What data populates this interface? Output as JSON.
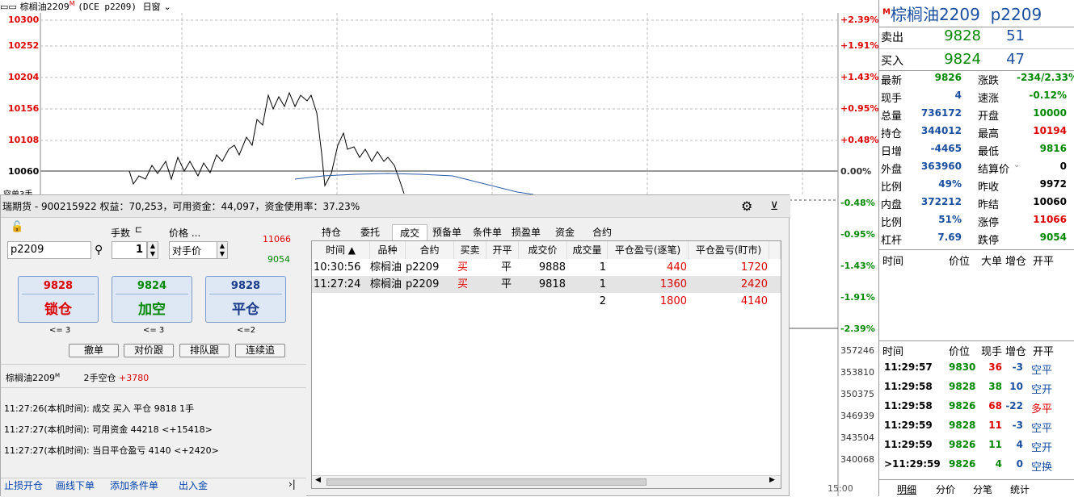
{
  "chart": {
    "instrument_tag": "棕榈油2209",
    "instrument_sup": "M",
    "instrument_code": "(DCE p2209)",
    "period": "日窗",
    "y_labels": [
      "10300",
      "10252",
      "10204",
      "10156",
      "10108",
      "10060"
    ],
    "pct_labels": [
      "+2.39%",
      "+1.91%",
      "+1.43%",
      "+0.95%",
      "+0.48%",
      "0.00%",
      "-0.48%",
      "-0.95%",
      "-1.43%",
      "-1.91%",
      "-2.39%"
    ],
    "vol_labels": [
      "357246",
      "353810",
      "350375",
      "346939",
      "343504",
      "340068"
    ],
    "partial_label": "空单3手",
    "time_label": "15:00"
  },
  "quote": {
    "title_sup": "M",
    "title": "棕榈油2209",
    "code": "p2209",
    "sell_label": "卖出",
    "sell_price": "9828",
    "sell_vol": "51",
    "buy_label": "买入",
    "buy_price": "9824",
    "buy_vol": "47",
    "rows": [
      {
        "k1": "最新",
        "v1": "9826",
        "k2": "涨跌",
        "v2": "-234/2.33%"
      },
      {
        "k1": "现手",
        "v1": "4",
        "k2": "速涨",
        "v2": "-0.12%"
      },
      {
        "k1": "总量",
        "v1": "736172",
        "k2": "开盘",
        "v2": "10000"
      },
      {
        "k1": "持仓",
        "v1": "344012",
        "k2": "最高",
        "v2": "10194"
      },
      {
        "k1": "日增",
        "v1": "-4465",
        "k2": "最低",
        "v2": "9816"
      },
      {
        "k1": "外盘",
        "v1": "363960",
        "k2": "结算价",
        "v2": "0"
      },
      {
        "k1": "比例",
        "v1": "49%",
        "k2": "昨收",
        "v2": "9972"
      },
      {
        "k1": "内盘",
        "v1": "372212",
        "k2": "昨结",
        "v2": "10060"
      },
      {
        "k1": "比例",
        "v1": "51%",
        "k2": "涨停",
        "v2": "11066"
      },
      {
        "k1": "杠杆",
        "v1": "7.69",
        "k2": "跌停",
        "v2": "9054"
      }
    ],
    "big_header": [
      "时间",
      "价位",
      "大单",
      "增仓",
      "开平"
    ],
    "tick_header": [
      "时间",
      "价位",
      "现手",
      "增仓",
      "开平"
    ],
    "ticks": [
      {
        "t": "11:29:57",
        "p": "9830",
        "v": "36",
        "d": "-3",
        "kp": "空平"
      },
      {
        "t": "11:29:58",
        "p": "9828",
        "v": "38",
        "d": "10",
        "kp": "空开"
      },
      {
        "t": "11:29:58",
        "p": "9826",
        "v": "68",
        "d": "-22",
        "kp": "多平"
      },
      {
        "t": "11:29:59",
        "p": "9828",
        "v": "11",
        "d": "-3",
        "kp": "空平"
      },
      {
        "t": "11:29:59",
        "p": "9826",
        "v": "11",
        "d": "4",
        "kp": "空开"
      },
      {
        "t": ">11:29:59",
        "p": "9826",
        "v": "4",
        "d": "0",
        "kp": "空换"
      }
    ],
    "bottom_tabs": [
      "明细",
      "分价",
      "分笔",
      "统计"
    ]
  },
  "trade": {
    "title": "瑞期货 - 900215922  权益：70,253，可用资金：44,097，资金使用率：37.23%",
    "lots_label": "手数",
    "price_label": "价格 ...",
    "contract": "p2209",
    "lots_value": "1",
    "price_mode": "对手价",
    "limit_up": "11066",
    "limit_down": "9054",
    "btn_lock_price": "9828",
    "btn_lock_label": "锁仓",
    "btn_add_price": "9824",
    "btn_add_label": "加空",
    "btn_close_price": "9828",
    "btn_close_label": "平仓",
    "cap1": "<= 3",
    "cap2": "<= 3",
    "cap3": "<=2",
    "small_btns": [
      "撤单",
      "对价跟",
      "排队跟",
      "连续追"
    ],
    "pos_name": "棕榈油2209",
    "pos_sup": "M",
    "pos_desc": "2手空仓",
    "pos_pnl": "+3780",
    "logs": [
      "11:27:26(本机时间): 成交  买入  平仓  9818  1手",
      "11:27:27(本机时间): 可用资金 44218  <+15418>",
      "11:27:27(本机时间): 当日平仓盈亏 4140  <+2420>"
    ],
    "links": [
      "止损开仓",
      "画线下单",
      "添加条件单",
      "出入金"
    ],
    "tabs": [
      "持仓",
      "委托",
      "成交",
      "预备单",
      "条件单",
      "损盈单",
      "资金",
      "合约"
    ],
    "columns": [
      "时间 ▲",
      "品种",
      "合约",
      "买卖",
      "开平",
      "成交价",
      "成交量",
      "平仓盈亏(逐笔)",
      "平仓盈亏(盯市)"
    ],
    "rows": [
      {
        "time": "10:30:56",
        "name": "棕榈油",
        "code": "p2209",
        "side": "买",
        "oc": "平",
        "price": "9888",
        "qty": "1",
        "pnl1": "440",
        "pnl2": "1720"
      },
      {
        "time": "11:27:24",
        "name": "棕榈油",
        "code": "p2209",
        "side": "买",
        "oc": "平",
        "price": "9818",
        "qty": "1",
        "pnl1": "1360",
        "pnl2": "2420"
      }
    ],
    "total": {
      "qty": "2",
      "pnl1": "1800",
      "pnl2": "4140"
    }
  }
}
